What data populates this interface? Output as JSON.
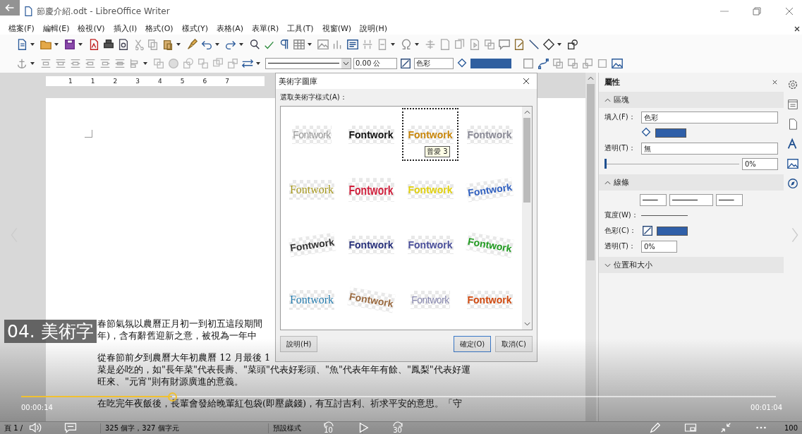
{
  "window": {
    "title": "節慶介紹.odt - LibreOffice Writer"
  },
  "menu": [
    "檔案(F)",
    "編輯(E)",
    "檢視(V)",
    "插入(I)",
    "格式(O)",
    "樣式(Y)",
    "表格(A)",
    "表單(R)",
    "工具(T)",
    "視窗(W)",
    "說明(H)"
  ],
  "toolbar_2": {
    "line_width": "0.00 公",
    "area_style": "色彩"
  },
  "ruler": [
    "1",
    "1",
    "2",
    "3",
    "4",
    "5",
    "6",
    "7"
  ],
  "document": {
    "paragraphs": [
      [
        "春節氣氛以農曆正月初一到初五這段期間",
        "年)，含有辭舊迎新之意，被視為一年中"
      ],
      [
        "從春節前夕到農曆大年初農曆 12 月最後 1",
        "菜是必吃的，如\"長年菜\"代表長壽、\"菜頭\"代表好彩頭、\"魚\"代表年年有餘、\"鳳梨\"代表好運",
        "旺來、\"元宵\"則有財源廣進的意義。"
      ],
      [
        "在吃完年夜飯後，長輩會發給晚輩紅包袋(即壓歲錢)，有互討吉利、祈求平安的意思。「守"
      ]
    ]
  },
  "dialog": {
    "title": "美術字圖庫",
    "label": "選取美術字樣式(A)：",
    "tooltip": "普愛 3",
    "styles": [
      {
        "label": "Fontwork",
        "color": "#9a9a9a",
        "selected": false
      },
      {
        "label": "Fontwork",
        "color": "#111111",
        "selected": false
      },
      {
        "label": "Fontwork",
        "color": "#c8860a",
        "selected": true
      },
      {
        "label": "Fontwork",
        "color": "#8a8a96",
        "selected": false
      },
      {
        "label": "Fontwork",
        "color": "#a89a20",
        "selected": false
      },
      {
        "label": "Fontwork",
        "color": "#d0203c",
        "selected": false
      },
      {
        "label": "Fontwork",
        "color": "#e0d010",
        "selected": false
      },
      {
        "label": "Fontwork",
        "color": "#2f5fbf",
        "selected": false
      },
      {
        "label": "Fontwork",
        "color": "#333333",
        "selected": false
      },
      {
        "label": "Fontwork",
        "color": "#27307a",
        "selected": false
      },
      {
        "label": "Fontwork",
        "color": "#4a4f9a",
        "selected": false
      },
      {
        "label": "Fontwork",
        "color": "#1f9a1f",
        "selected": false
      },
      {
        "label": "Fontwork",
        "color": "#2a7fb0",
        "selected": false
      },
      {
        "label": "Fontwork",
        "color": "#9a6a40",
        "selected": false
      },
      {
        "label": "Fontwork",
        "color": "#8a8ab0",
        "selected": false
      },
      {
        "label": "Fontwork",
        "color": "#d04a10",
        "selected": false
      }
    ],
    "buttons": [
      {
        "label": "說明(H)",
        "kind": "help"
      },
      {
        "label": "確定(O)",
        "kind": "default"
      },
      {
        "label": "取消(C)",
        "kind": "normal"
      }
    ]
  },
  "sidebar": {
    "title": "屬性",
    "area": {
      "title": "區塊",
      "expanded": true,
      "fill_label": "填入(F)：",
      "fill": "色彩",
      "transparency_label": "透明(T)：",
      "transparency": "無",
      "slider": {
        "level": 0
      },
      "percent": "0%"
    },
    "line": {
      "title": "線條",
      "expanded": true,
      "width_label": "寬度(W)：",
      "color_label": "色彩(C)：",
      "transparency_label": "透明(T)：",
      "transparency": "0%"
    },
    "position": {
      "title": "位置和大小",
      "expanded": false
    }
  },
  "status_bar": {
    "page": "頁 1 /",
    "words": "325 個字，327 個字元",
    "page_style": "預設樣式",
    "zoom": "100"
  },
  "video": {
    "title": "04. 美術字",
    "elapsed": "00:00:14",
    "duration": "00:01:04",
    "progress": {
      "level": 0.2
    },
    "skip_back": "10",
    "skip_forward": "30"
  }
}
